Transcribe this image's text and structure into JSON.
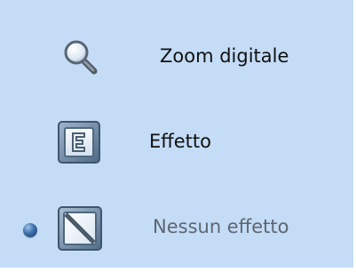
{
  "menu": {
    "items": [
      {
        "label": "Zoom digitale",
        "icon": "magnifier-icon"
      },
      {
        "label": "Effetto",
        "icon": "effect-icon"
      },
      {
        "label": "Nessun effetto",
        "icon": "no-effect-icon",
        "selected": true
      }
    ]
  },
  "colors": {
    "panel_background": "#c4dcf6",
    "disabled_text": "#5e6670",
    "selected_indicator": "#3b6fa8"
  }
}
